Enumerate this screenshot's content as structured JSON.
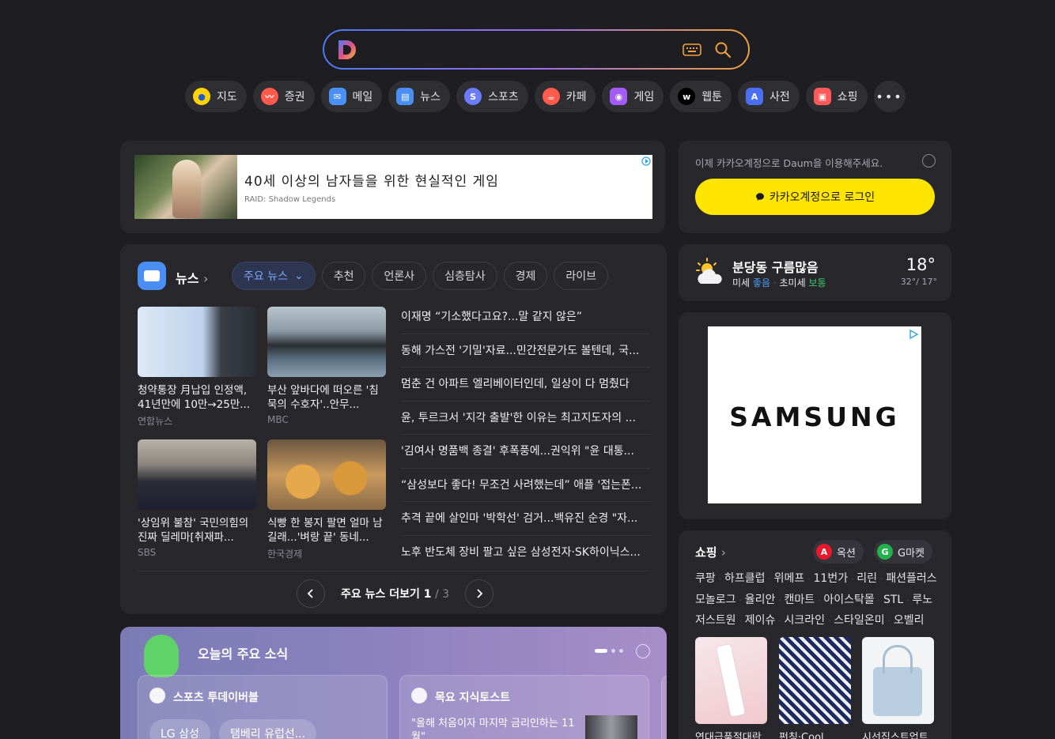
{
  "search": {
    "placeholder": ""
  },
  "shortcuts": [
    {
      "label": "지도",
      "icon": "map-pin-icon",
      "color": "#ffd400"
    },
    {
      "label": "증권",
      "icon": "stock-chart-icon",
      "color": "#ff5a4b"
    },
    {
      "label": "메일",
      "icon": "mail-icon",
      "color": "#4a8ff5"
    },
    {
      "label": "뉴스",
      "icon": "news-icon",
      "color": "#4a8ff5"
    },
    {
      "label": "스포츠",
      "icon": "sports-icon",
      "color": "#6b7cff"
    },
    {
      "label": "카페",
      "icon": "cafe-icon",
      "color": "#ff5a4b"
    },
    {
      "label": "게임",
      "icon": "game-icon",
      "color": "#a35cf5"
    },
    {
      "label": "웹툰",
      "icon": "webtoon-icon",
      "color": "#000000"
    },
    {
      "label": "사전",
      "icon": "dictionary-icon",
      "color": "#4a6ff5"
    },
    {
      "label": "쇼핑",
      "icon": "shopping-bag-icon",
      "color": "#ff5a5a"
    }
  ],
  "ad_banner": {
    "title": "40세 이상의 남자들을 위한 현실적인 게임",
    "source": "RAID: Shadow Legends"
  },
  "news": {
    "title": "뉴스",
    "tabs": [
      "주요 뉴스",
      "추천",
      "언론사",
      "심층탐사",
      "경제",
      "라이브"
    ],
    "cards": [
      {
        "headline": "청약통장 月납입 인정액, 41년만에 10만→25만...",
        "press": "연합뉴스"
      },
      {
        "headline": "부산 앞바다에 떠오른 '침묵의 수호자'..안무...",
        "press": "MBC"
      },
      {
        "headline": "'상임위 불참' 국민의힘의 진짜 딜레마[취재파...",
        "press": "SBS"
      },
      {
        "headline": "식빵 한 봉지 팔면 얼마 남길래...'벼랑 끝' 동네...",
        "press": "한국경제"
      }
    ],
    "headlines": [
      "이재명 “기소했다고요?...말 같지 않은”",
      "동해 가스전 '기밀'자료...민간전문가도 볼텐데, 국...",
      "멈춘 건 아파트 엘리베이터인데, 일상이 다 멈췄다",
      "윤, 투르크서 '지각 출발'한 이유는 최고지도자의 ...",
      "'김여사 명품백 종결' 후폭풍에...권익위 \"윤 대통...",
      "“삼성보다 좋다! 무조건 사려했는데” 애플 '접는폰...",
      "추격 끝에 살인마 '박학선' 검거...백유진 순경 \"자...",
      "노후 반도체 장비 팔고 싶은 삼성전자·SK하이닉스..."
    ],
    "more_label": "주요 뉴스 더보기",
    "page_current": "1",
    "page_total": " / 3"
  },
  "today": {
    "title": "오늘의 주요 소식",
    "cards": [
      {
        "title": "스포츠 투데이버블",
        "chips": [
          "LG 삼성",
          "탬베리 유럽선..."
        ]
      },
      {
        "title": "목요 지식토스트",
        "text": "\"올해 처음이자 마지막 금리인하는 11월\""
      }
    ]
  },
  "login": {
    "message": "이제 카카오계정으로 Daum을 이용해주세요.",
    "button": "카카오계정으로 로그인"
  },
  "weather": {
    "location": "분당동 구름많음",
    "fine_dust_label": "미세",
    "fine_dust_value": "좋음",
    "ultra_dust_label": "초미세",
    "ultra_dust_value": "보통",
    "temp": "18°",
    "range": "32°/ 17°"
  },
  "ad_side": {
    "brand": "SAMSUNG"
  },
  "shopping": {
    "title": "쇼핑",
    "partners": [
      {
        "label": "옥션",
        "badge": "A",
        "color": "#e8192c"
      },
      {
        "label": "G마켓",
        "badge": "G",
        "color": "#23b14d"
      }
    ],
    "links": [
      "쿠팡",
      "하프클럽",
      "위메프",
      "11번가",
      "리린",
      "패션플러스",
      "모놀로그",
      "율리안",
      "캔마트",
      "아이스탁몰",
      "STL",
      "루노",
      "저스트원",
      "제이슈",
      "시크라인",
      "스타일온미",
      "오벨리"
    ],
    "products": [
      "연대급품절대란",
      "펀칭·Cool",
      "시선집스트업트"
    ]
  }
}
